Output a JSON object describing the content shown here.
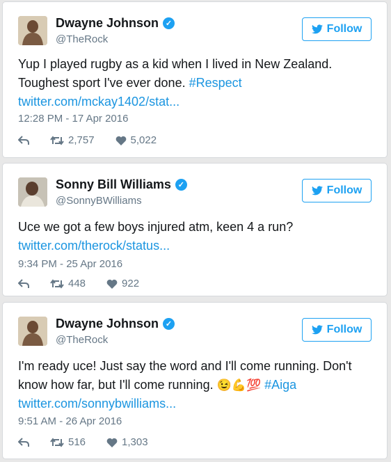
{
  "follow_label": "Follow",
  "colors": {
    "accent": "#1da1f2",
    "link": "#1b95e0",
    "muted": "#657786",
    "verified": "#1da1f2"
  },
  "tweets": [
    {
      "name": "Dwayne Johnson",
      "handle": "@TheRock",
      "text_line1": "Yup I played rugby as a kid when I lived in New Zealand.",
      "text_line2": "Toughest sport I've ever done.",
      "hashtag": "#Respect",
      "link": "twitter.com/mckay1402/stat...",
      "timestamp": "12:28 PM - 17 Apr 2016",
      "retweets": "2,757",
      "likes": "5,022"
    },
    {
      "name": "Sonny Bill Williams",
      "handle": "@SonnyBWilliams",
      "text_line1": "Uce we got a few boys injured atm, keen 4 a run?",
      "link": "twitter.com/therock/status...",
      "timestamp": "9:34 PM - 25 Apr 2016",
      "retweets": "448",
      "likes": "922"
    },
    {
      "name": "Dwayne Johnson",
      "handle": "@TheRock",
      "text_line1": "I'm ready uce! Just say the word and I'll come running. Don't",
      "text_line2": "know how far, but I'll come running.",
      "emojis": "😉💪💯",
      "hashtag": "#Aiga",
      "link": "twitter.com/sonnybwilliams...",
      "timestamp": "9:51 AM - 26 Apr 2016",
      "retweets": "516",
      "likes": "1,303"
    }
  ]
}
